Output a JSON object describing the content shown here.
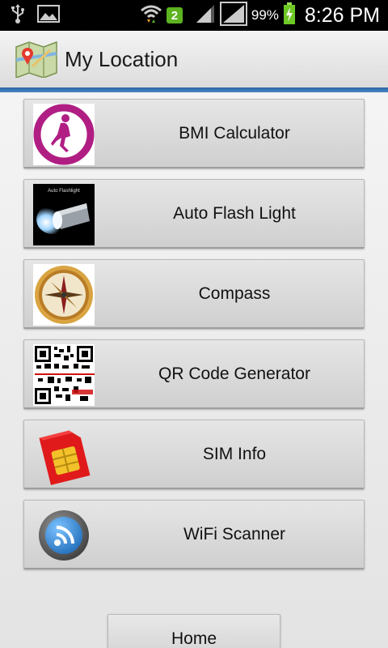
{
  "status_bar": {
    "time": "8:26 PM",
    "battery_percent": "99%",
    "notification_count": "2",
    "icons": [
      "usb-icon",
      "image-icon",
      "wifi-icon",
      "notification-badge",
      "signal-icon",
      "signal-icon",
      "battery-charging-icon"
    ]
  },
  "action_bar": {
    "title": "My Location",
    "icon": "map-pin-icon"
  },
  "menu": {
    "items": [
      {
        "label": "BMI Calculator",
        "icon": "bmi-runner-icon"
      },
      {
        "label": "Auto Flash Light",
        "icon": "flashlight-icon",
        "icon_caption": "Auto Flashlight"
      },
      {
        "label": "Compass",
        "icon": "compass-icon"
      },
      {
        "label": "QR Code Generator",
        "icon": "qr-code-icon"
      },
      {
        "label": "SIM Info",
        "icon": "sim-card-icon"
      },
      {
        "label": "WiFi Scanner",
        "icon": "wifi-scanner-icon"
      }
    ]
  },
  "home_button": {
    "label": "Home"
  },
  "colors": {
    "accent_bar": "#2a67a8",
    "bmi_magenta": "#b01e83",
    "sim_red": "#e01a1a",
    "wifi_blue": "#3a8ed8"
  }
}
